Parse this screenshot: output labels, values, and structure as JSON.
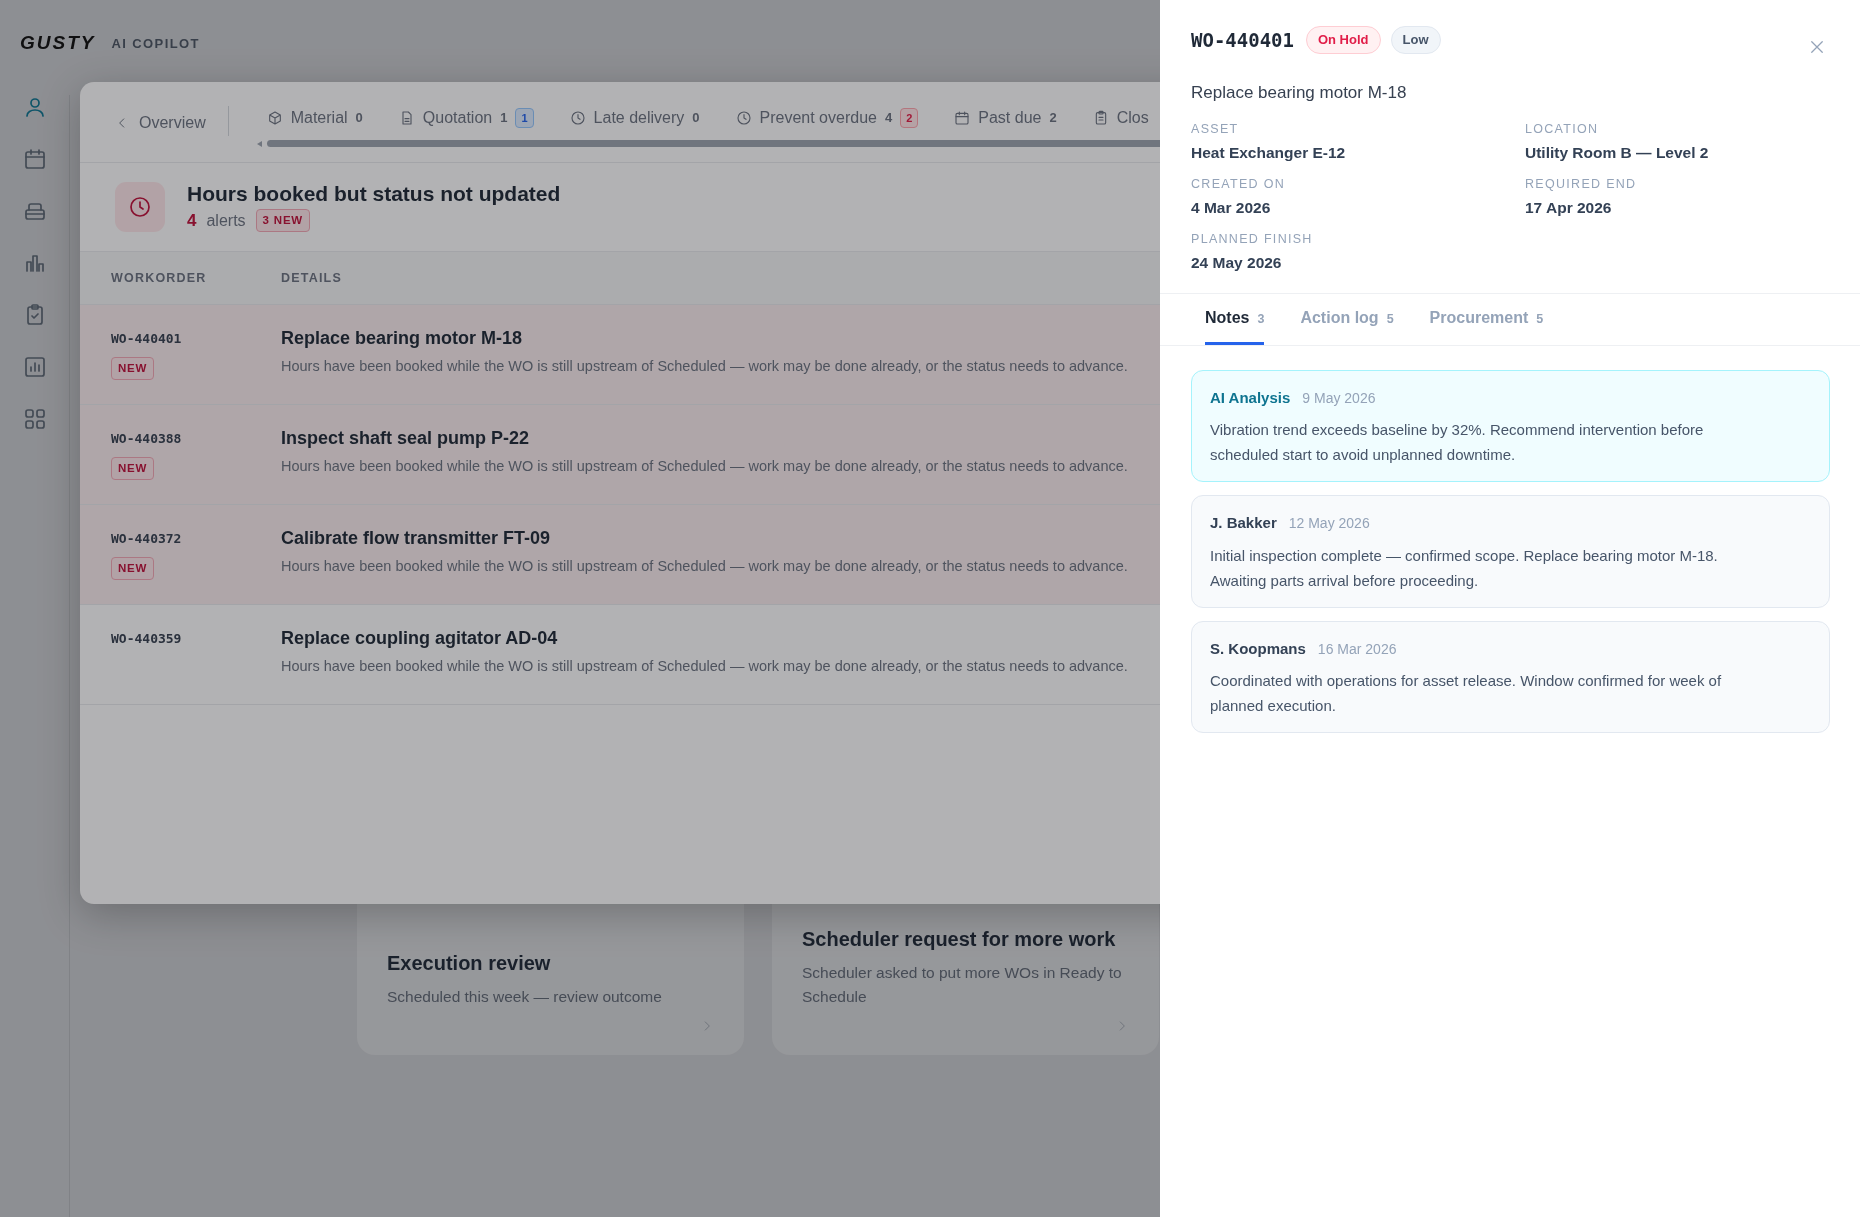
{
  "app": {
    "logo": "GUSTY",
    "product": "AI COPILOT"
  },
  "sidebar": {
    "items": [
      {
        "selected": true
      },
      {
        "selected": false
      },
      {
        "selected": false
      },
      {
        "selected": false
      },
      {
        "selected": false
      },
      {
        "selected": false
      },
      {
        "selected": false
      }
    ]
  },
  "background_cards": [
    {
      "title": "Execution review",
      "subtitle": "Scheduled this week — review outcome"
    },
    {
      "title": "Scheduler request for more work",
      "subtitle": "Scheduler asked to put more WOs in Ready to Schedule"
    }
  ],
  "dialog": {
    "back_label": "Overview",
    "tabs": [
      {
        "label": "Material",
        "count": "0"
      },
      {
        "label": "Quotation",
        "count": "1",
        "badge": {
          "text": "1",
          "kind": "info"
        }
      },
      {
        "label": "Late delivery",
        "count": "0"
      },
      {
        "label": "Prevent overdue",
        "count": "4",
        "badge": {
          "text": "2",
          "kind": "alert"
        }
      },
      {
        "label": "Past due",
        "count": "2"
      },
      {
        "label": "Clos"
      }
    ],
    "alert": {
      "title": "Hours booked but status not updated",
      "count": "4",
      "count_label": "alerts",
      "new_badge": "3 NEW"
    },
    "table": {
      "columns": [
        "WORKORDER",
        "DETAILS"
      ],
      "rows": [
        {
          "workorder": "WO-440401",
          "new": true,
          "badge": "NEW",
          "title": "Replace bearing motor M-18",
          "description": "Hours have been booked while the WO is still upstream of Scheduled — work may be done already, or the status needs to advance."
        },
        {
          "workorder": "WO-440388",
          "new": true,
          "badge": "NEW",
          "title": "Inspect shaft seal pump P-22",
          "description": "Hours have been booked while the WO is still upstream of Scheduled — work may be done already, or the status needs to advance."
        },
        {
          "workorder": "WO-440372",
          "new": true,
          "badge": "NEW",
          "title": "Calibrate flow transmitter FT-09",
          "description": "Hours have been booked while the WO is still upstream of Scheduled — work may be done already, or the status needs to advance."
        },
        {
          "workorder": "WO-440359",
          "new": false,
          "title": "Replace coupling agitator AD-04",
          "description": "Hours have been booked while the WO is still upstream of Scheduled — work may be done already, or the status needs to advance."
        }
      ]
    }
  },
  "drawer": {
    "workorder": "WO-440401",
    "badges": [
      {
        "text": "On Hold",
        "kind": "status"
      },
      {
        "text": "Low",
        "kind": "priority"
      }
    ],
    "title": "Replace bearing motor M-18",
    "fields": [
      {
        "label": "ASSET",
        "value": "Heat Exchanger E-12"
      },
      {
        "label": "LOCATION",
        "value": "Utility Room B — Level 2"
      },
      {
        "label": "CREATED ON",
        "value": "4 Mar 2026"
      },
      {
        "label": "REQUIRED END",
        "value": "17 Apr 2026"
      },
      {
        "label": "PLANNED FINISH",
        "value": "24 May 2026"
      }
    ],
    "tabs": [
      {
        "label": "Notes",
        "count": "3",
        "selected": true
      },
      {
        "label": "Action log",
        "count": "5",
        "selected": false
      },
      {
        "label": "Procurement",
        "count": "5",
        "selected": false
      }
    ],
    "notes": [
      {
        "kind": "ai",
        "author": "AI Analysis",
        "date": "9 May 2026",
        "text": "Vibration trend exceeds baseline by 32%. Recommend intervention before scheduled start to avoid unplanned downtime."
      },
      {
        "kind": "user",
        "author": "J. Bakker",
        "date": "12 May 2026",
        "text": "Initial inspection complete — confirmed scope. Replace bearing motor M-18. Awaiting parts arrival before proceeding."
      },
      {
        "kind": "user",
        "author": "S. Koopmans",
        "date": "16 Mar 2026",
        "text": "Coordinated with operations for asset release. Window confirmed for week of planned execution."
      }
    ]
  }
}
